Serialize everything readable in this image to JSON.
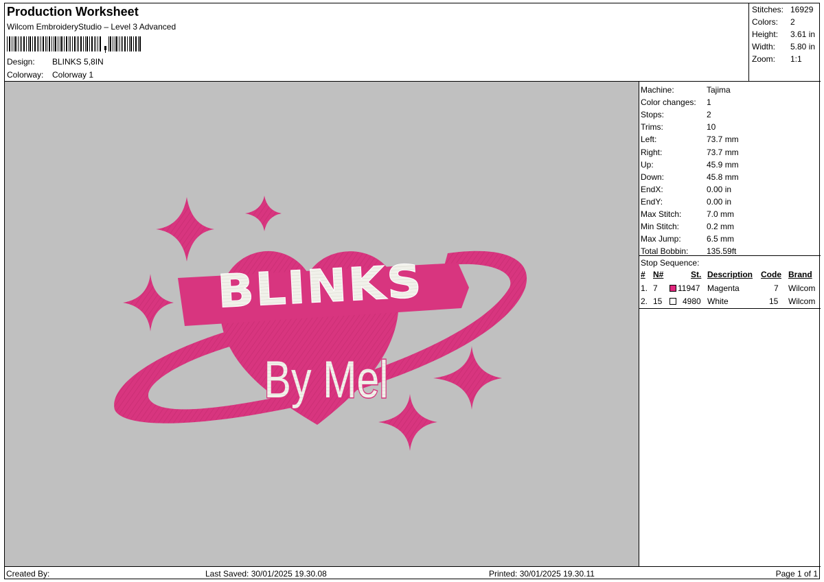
{
  "header": {
    "title": "Production Worksheet",
    "subtitle": "Wilcom EmbroideryStudio – Level 3 Advanced",
    "design_label": "Design:",
    "design_value": "BLINKS 5,8IN",
    "colorway_label": "Colorway:",
    "colorway_value": "Colorway 1"
  },
  "summary": {
    "stitches_label": "Stitches:",
    "stitches_value": "16929",
    "colors_label": "Colors:",
    "colors_value": "2",
    "height_label": "Height:",
    "height_value": "3.61 in",
    "width_label": "Width:",
    "width_value": "5.80 in",
    "zoom_label": "Zoom:",
    "zoom_value": "1:1"
  },
  "machine": [
    {
      "label": "Machine:",
      "value": "Tajima"
    },
    {
      "label": "Color changes:",
      "value": "1"
    },
    {
      "label": "Stops:",
      "value": "2"
    },
    {
      "label": "Trims:",
      "value": "10"
    },
    {
      "label": "Left:",
      "value": "73.7 mm"
    },
    {
      "label": "Right:",
      "value": "73.7 mm"
    },
    {
      "label": "Up:",
      "value": "45.9 mm"
    },
    {
      "label": "Down:",
      "value": "45.8 mm"
    },
    {
      "label": "EndX:",
      "value": "0.00 in"
    },
    {
      "label": "EndY:",
      "value": "0.00 in"
    },
    {
      "label": "Max Stitch:",
      "value": "7.0 mm"
    },
    {
      "label": "Min Stitch:",
      "value": "0.2 mm"
    },
    {
      "label": "Max Jump:",
      "value": "6.5 mm"
    },
    {
      "label": "Total Bobbin:",
      "value": "135.59ft"
    }
  ],
  "stop_sequence": {
    "title": "Stop Sequence:",
    "headers": {
      "num": "#",
      "needle": "N#",
      "stitches": "St.",
      "description": "Description",
      "code": "Code",
      "brand": "Brand"
    },
    "rows": [
      {
        "num": "1.",
        "needle": "7",
        "color": "#e0267d",
        "stitches": "11947",
        "description": "Magenta",
        "code": "7",
        "brand": "Wilcom"
      },
      {
        "num": "2.",
        "needle": "15",
        "color": "#ffffff",
        "stitches": "4980",
        "description": "White",
        "code": "15",
        "brand": "Wilcom"
      }
    ]
  },
  "design": {
    "word1": "BLINKS",
    "word2": "By Mel",
    "magenta": "#d8357f",
    "white": "#f1f1ea"
  },
  "footer": {
    "created_by": "Created By:",
    "last_saved": "Last Saved: 30/01/2025 19.30.08",
    "printed": "Printed: 30/01/2025 19.30.11",
    "page": "Page 1 of 1"
  }
}
